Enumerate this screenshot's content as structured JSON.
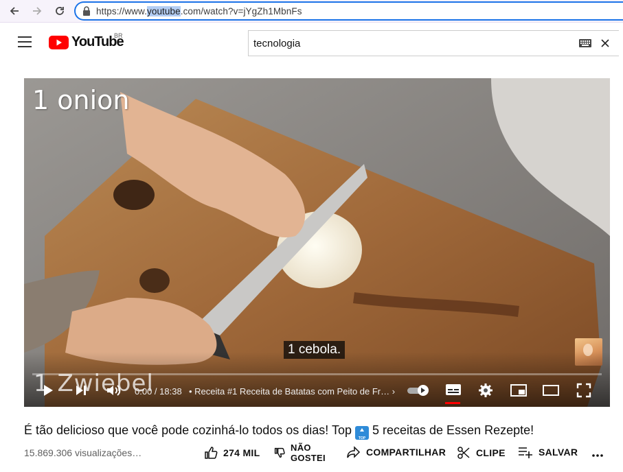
{
  "browser": {
    "url_prefix": "https://www.",
    "url_highlight": "youtube",
    "url_suffix": ".com/watch?v=jYgZh1MbnFs"
  },
  "header": {
    "logo_text": "YouTube",
    "country_code": "BR",
    "search_value": "tecnologia"
  },
  "video": {
    "overlay_text": "1 onion",
    "caption": "1 cebola.",
    "watermark": "1 Zwiebel",
    "time": "0:00 / 18:38",
    "chapter": "• Receita #1 Receita de Batatas com Peito de Fr…",
    "progress_fraction": 0
  },
  "details": {
    "title_part1": "É tão delicioso que você pode cozinhá-lo todos os dias! Top ",
    "title_badge": "TOP",
    "title_part2": " 5 receitas de Essen Rezepte!",
    "views": "15.869.306 visualizações…",
    "like_label": "274 MIL",
    "dislike_label_line1": "NÃO",
    "dislike_label_line2": "GOSTEI",
    "share_label": "COMPARTILHAR",
    "clip_label": "CLIPE",
    "save_label": "SALVAR"
  },
  "colors": {
    "accent": "#1a73e8",
    "youtube_red": "#ff0000"
  }
}
